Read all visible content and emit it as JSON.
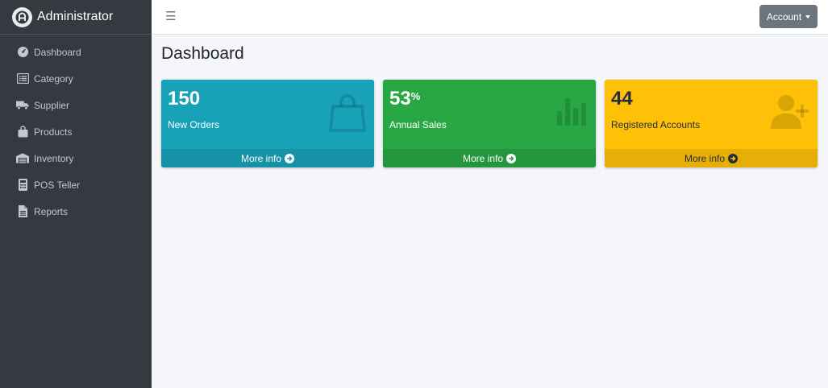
{
  "brand": {
    "title": "Administrator",
    "icon": "brand-logo-icon"
  },
  "sidebar": {
    "items": [
      {
        "label": "Dashboard",
        "icon": "tachometer-icon"
      },
      {
        "label": "Category",
        "icon": "list-icon"
      },
      {
        "label": "Supplier",
        "icon": "truck-icon"
      },
      {
        "label": "Products",
        "icon": "shopping-bag-icon"
      },
      {
        "label": "Inventory",
        "icon": "warehouse-icon"
      },
      {
        "label": "POS Teller",
        "icon": "calculator-icon"
      },
      {
        "label": "Reports",
        "icon": "file-icon"
      }
    ]
  },
  "topbar": {
    "menu_icon": "☰",
    "account_label": "Account"
  },
  "page": {
    "title": "Dashboard"
  },
  "boxes": [
    {
      "value": "150",
      "suffix": "",
      "label": "New Orders",
      "footer": "More info",
      "color": "#17a2b8",
      "icon": "shopping-bag-icon"
    },
    {
      "value": "53",
      "suffix": "%",
      "label": "Annual Sales",
      "footer": "More info",
      "color": "#28a745",
      "icon": "bar-chart-icon"
    },
    {
      "value": "44",
      "suffix": "",
      "label": "Registered Accounts",
      "footer": "More info",
      "color": "#ffc107",
      "icon": "user-plus-icon"
    }
  ]
}
